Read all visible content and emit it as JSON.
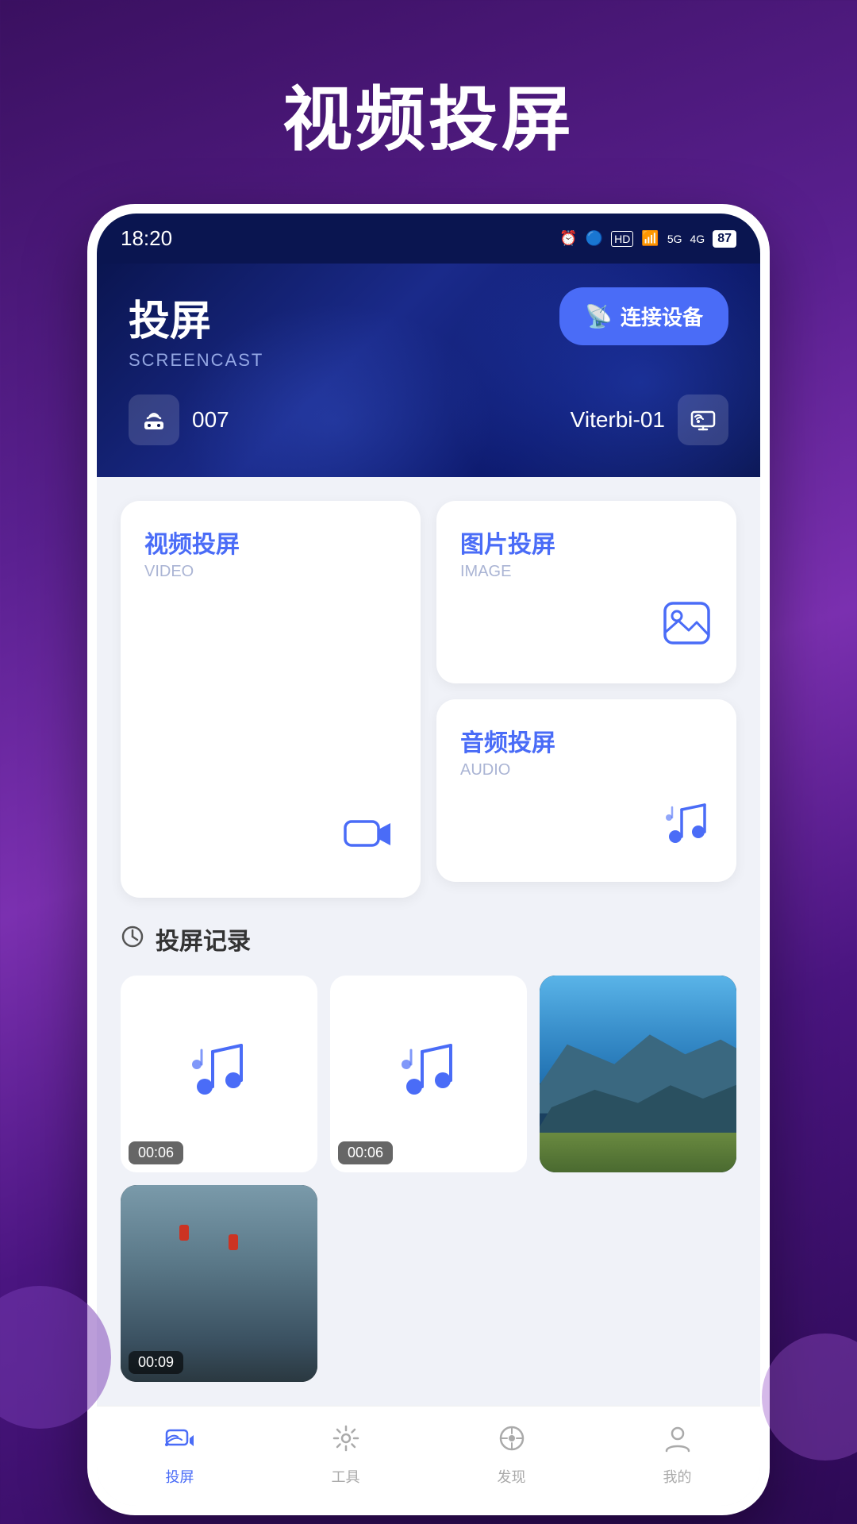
{
  "page": {
    "title": "视频投屏",
    "background": "#5a2090"
  },
  "status_bar": {
    "time": "18:20",
    "battery": "87"
  },
  "header": {
    "title_cn": "投屏",
    "title_en": "SCREENCAST",
    "connect_btn": "连接设备",
    "wifi_id": "007",
    "device_name": "Viterbi-01"
  },
  "cast_cards": [
    {
      "id": "video",
      "title_cn": "视频投屏",
      "title_en": "VIDEO",
      "icon": "video"
    },
    {
      "id": "image",
      "title_cn": "图片投屏",
      "title_en": "IMAGE",
      "icon": "image"
    },
    {
      "id": "audio",
      "title_cn": "音频投屏",
      "title_en": "AUDIO",
      "icon": "music"
    }
  ],
  "history_section": {
    "title": "投屏记录",
    "items": [
      {
        "type": "audio",
        "duration": "00:06"
      },
      {
        "type": "audio",
        "duration": "00:06"
      },
      {
        "type": "image_landscape",
        "duration": null
      },
      {
        "type": "image_alley",
        "duration": "00:09"
      }
    ]
  },
  "bottom_nav": {
    "items": [
      {
        "id": "cast",
        "label": "投屏",
        "active": true
      },
      {
        "id": "tools",
        "label": "工具",
        "active": false
      },
      {
        "id": "discover",
        "label": "发现",
        "active": false
      },
      {
        "id": "profile",
        "label": "我的",
        "active": false
      }
    ]
  }
}
